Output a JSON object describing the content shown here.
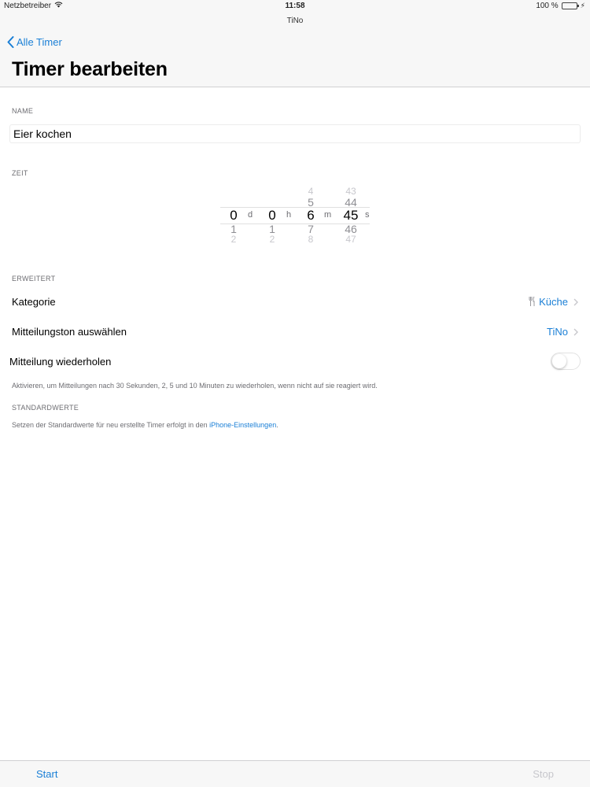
{
  "status_bar": {
    "carrier": "Netzbetreiber",
    "time": "11:58",
    "battery": "100 %",
    "battery_level": 1.0
  },
  "app_name": "TiNo",
  "nav": {
    "back_label": "Alle Timer",
    "title": "Timer bearbeiten"
  },
  "name_section": {
    "label": "NAME",
    "value": "Eier kochen",
    "placeholder": ""
  },
  "time_section": {
    "label": "ZEIT",
    "picker": {
      "days": {
        "above2": "",
        "above1": "",
        "selected": "0",
        "below1": "1",
        "below2": "2",
        "unit": "d"
      },
      "hours": {
        "above2": "",
        "above1": "",
        "selected": "0",
        "below1": "1",
        "below2": "2",
        "unit": "h"
      },
      "minutes": {
        "above2": "4",
        "above1": "5",
        "selected": "6",
        "below1": "7",
        "below2": "8",
        "unit": "m"
      },
      "seconds": {
        "above2": "43",
        "above1": "44",
        "selected": "45",
        "below1": "46",
        "below2": "47",
        "unit": "s"
      }
    }
  },
  "advanced_section": {
    "label": "ERWEITERT",
    "category": {
      "label": "Kategorie",
      "value": "Küche",
      "icon": "fork-knife-icon"
    },
    "sound": {
      "label": "Mitteilungston auswählen",
      "value": "TiNo"
    },
    "repeat": {
      "label": "Mitteilung wiederholen",
      "enabled": false
    },
    "repeat_footnote": "Aktivieren, um Mitteilungen nach 30 Sekunden, 2, 5 und 10 Minuten zu wiederholen, wenn nicht auf sie reagiert wird."
  },
  "defaults_section": {
    "label": "STANDARDWERTE",
    "text": "Setzen der Standardwerte für neu erstellte Timer erfolgt in den ",
    "link": "iPhone-Einstellungen",
    "suffix": "."
  },
  "toolbar": {
    "start_label": "Start",
    "stop_label": "Stop"
  },
  "colors": {
    "accent": "#1a7fd6",
    "header_bg": "#f7f7f7",
    "secondary_text": "#6d6d72"
  }
}
